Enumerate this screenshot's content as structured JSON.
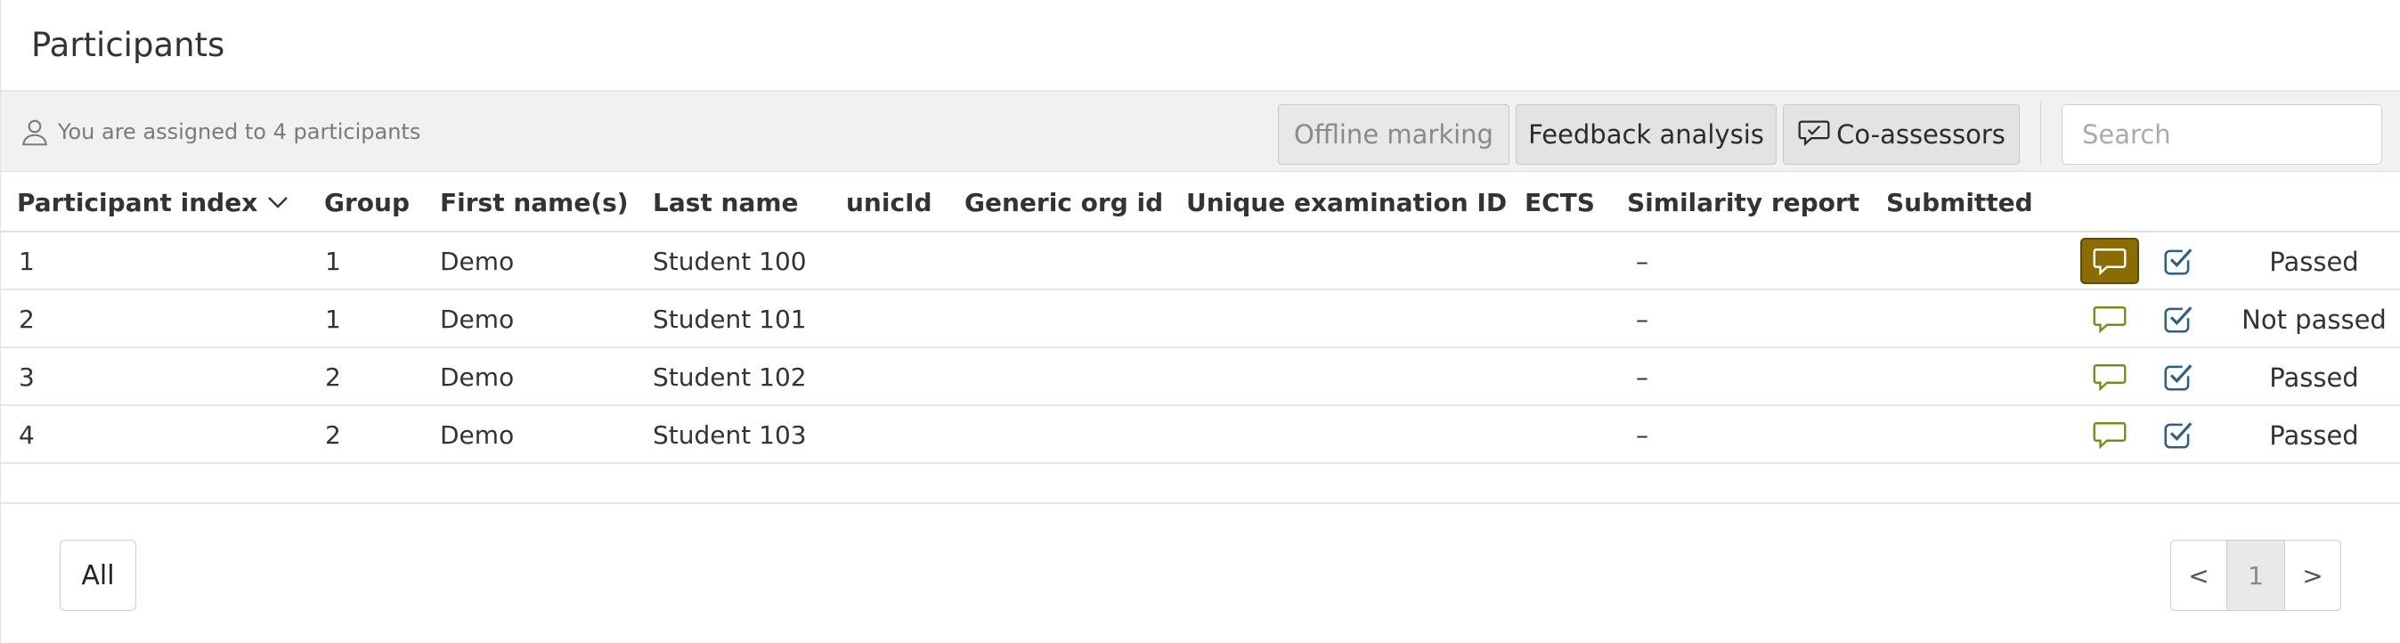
{
  "header": {
    "title": "Participants"
  },
  "toolbar": {
    "assigned_text": "You are assigned to 4 participants",
    "offline_marking_label": "Offline marking",
    "feedback_analysis_label": "Feedback analysis",
    "co_assessors_label": "Co-assessors",
    "search_placeholder": "Search"
  },
  "table": {
    "columns": [
      "Participant index",
      "Group",
      "First name(s)",
      "Last name",
      "unicId",
      "Generic org id",
      "Unique examination ID",
      "ECTS",
      "Similarity report",
      "Submitted"
    ],
    "rows": [
      {
        "index": "1",
        "group": "1",
        "first_name": "Demo",
        "last_name": "Student 100",
        "similarity": "–",
        "status": "Passed",
        "comment_active": true
      },
      {
        "index": "2",
        "group": "1",
        "first_name": "Demo",
        "last_name": "Student 101",
        "similarity": "–",
        "status": "Not passed",
        "comment_active": false
      },
      {
        "index": "3",
        "group": "2",
        "first_name": "Demo",
        "last_name": "Student 102",
        "similarity": "–",
        "status": "Passed",
        "comment_active": false
      },
      {
        "index": "4",
        "group": "2",
        "first_name": "Demo",
        "last_name": "Student 103",
        "similarity": "–",
        "status": "Passed",
        "comment_active": false
      }
    ]
  },
  "footer": {
    "all_label": "All",
    "pager": {
      "prev": "<",
      "current": "1",
      "next": ">"
    }
  },
  "colors": {
    "comment_olive": "#7c8a1a",
    "comment_active_bg": "#8a6c00",
    "check_blue": "#2e5e86"
  },
  "icons": {
    "user": "user-icon",
    "sort": "chevron-down-icon",
    "coassessors": "comment-check-icon",
    "comment": "comment-icon",
    "check": "checkbox-check-icon"
  }
}
